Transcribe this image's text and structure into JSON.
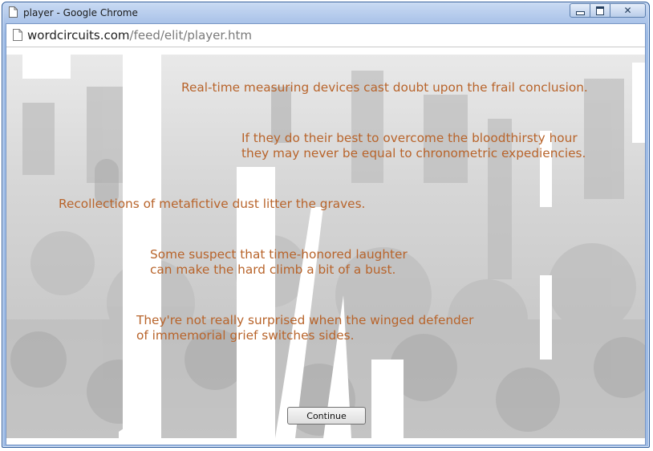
{
  "window": {
    "title": "player - Google Chrome",
    "controls": {
      "minimize_icon": "minimize-icon",
      "maximize_icon": "maximize-icon",
      "close_icon": "close-icon"
    }
  },
  "address_bar": {
    "host": "wordcircuits.com",
    "path": "/feed/elit/player.htm",
    "page_icon": "document-icon"
  },
  "poem": {
    "lines": [
      "Real-time measuring devices cast doubt upon the frail conclusion.",
      "If they do their best to overcome the bloodthirsty hour",
      "they may never be equal to chronometric expediencies.",
      "Recollections of metafictive dust litter the graves.",
      "Some suspect that time-honored laughter",
      "can make the hard climb a bit of a bust.",
      "They're not really surprised when the winged defender",
      "of immemorial grief switches sides."
    ],
    "text_color": "#b8642b"
  },
  "continue_button": {
    "label": "Continue"
  },
  "colors": {
    "titlebar": "#aec6ea",
    "background_art": "#cfcfcf"
  }
}
